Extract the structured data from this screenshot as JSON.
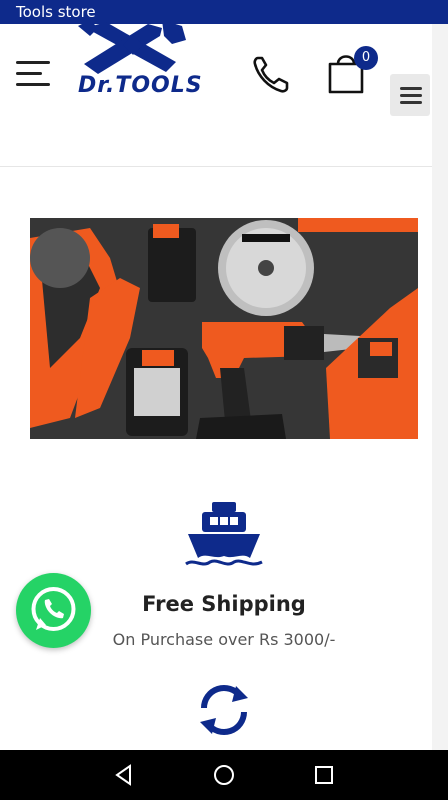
{
  "topbar": {
    "title": "Tools store"
  },
  "header": {
    "logo_text": "Dr.TOOLS",
    "cart_count": "0"
  },
  "icons": {
    "menu": "hamburger-icon",
    "phone": "phone-icon",
    "cart": "shopping-bag-icon",
    "mobile_menu": "menu-icon",
    "ship": "ship-icon",
    "refresh": "refresh-icon",
    "whatsapp": "whatsapp-icon",
    "nav_back": "back-triangle-icon",
    "nav_home": "home-circle-icon",
    "nav_recent": "recent-square-icon"
  },
  "feature": {
    "title": "Free Shipping",
    "subtitle": "On Purchase over Rs 3000/-"
  },
  "colors": {
    "brand": "#0e2a8b",
    "whatsapp": "#25d366",
    "tool_orange": "#ef5a1f"
  }
}
